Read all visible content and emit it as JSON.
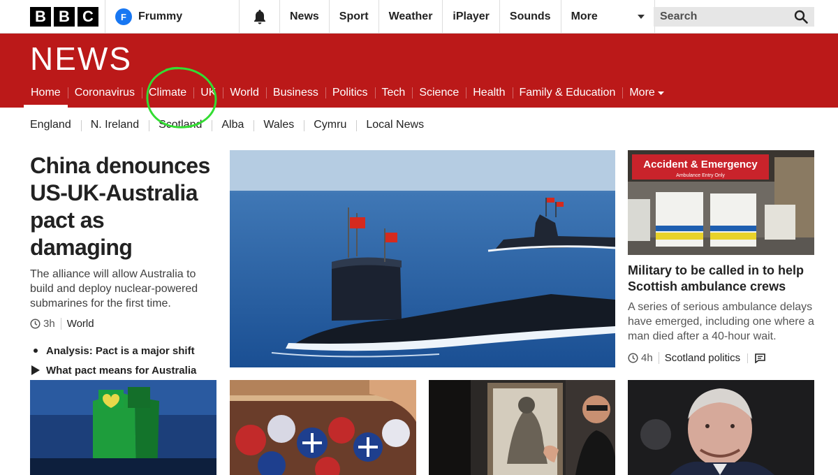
{
  "brand": {
    "letters": [
      "B",
      "B",
      "C"
    ]
  },
  "account": {
    "initial": "F",
    "name": "Frummy",
    "avatar_color": "#1877f2"
  },
  "topnav": {
    "items": [
      {
        "label": "News"
      },
      {
        "label": "Sport"
      },
      {
        "label": "Weather"
      },
      {
        "label": "iPlayer"
      },
      {
        "label": "Sounds"
      }
    ],
    "more_label": "More"
  },
  "search": {
    "placeholder": "Search"
  },
  "news": {
    "title": "NEWS",
    "brand_color": "#bb1919",
    "sections": [
      {
        "label": "Home",
        "active": true
      },
      {
        "label": "Coronavirus"
      },
      {
        "label": "Climate"
      },
      {
        "label": "UK"
      },
      {
        "label": "World"
      },
      {
        "label": "Business"
      },
      {
        "label": "Politics"
      },
      {
        "label": "Tech"
      },
      {
        "label": "Science"
      },
      {
        "label": "Health"
      },
      {
        "label": "Family & Education"
      }
    ],
    "more_label": "More"
  },
  "subnav": {
    "items": [
      "England",
      "N. Ireland",
      "Scotland",
      "Alba",
      "Wales",
      "Cymru",
      "Local News"
    ]
  },
  "lead_story": {
    "headline": "China denounces US-UK-Australia pact as damaging",
    "summary": "The alliance will allow Australia to build and deploy nuclear-powered submarines for the first time.",
    "time": "3h",
    "topic": "World",
    "related": [
      {
        "icon": "bullet",
        "label": "Analysis: Pact is a major shift"
      },
      {
        "icon": "play",
        "label": "What pact means for Australia"
      }
    ]
  },
  "side_story": {
    "sign_text": "Accident & Emergency",
    "sign_subtext": "Ambulance Entry Only",
    "headline": "Military to be called in to help Scottish ambulance crews",
    "summary": "A series of serious ambulance delays have emerged, including one where a man died after a 40-hour wait.",
    "time": "4h",
    "topic": "Scotland politics"
  },
  "annotation": {
    "circled_section": "Climate",
    "color": "#33dd33"
  }
}
